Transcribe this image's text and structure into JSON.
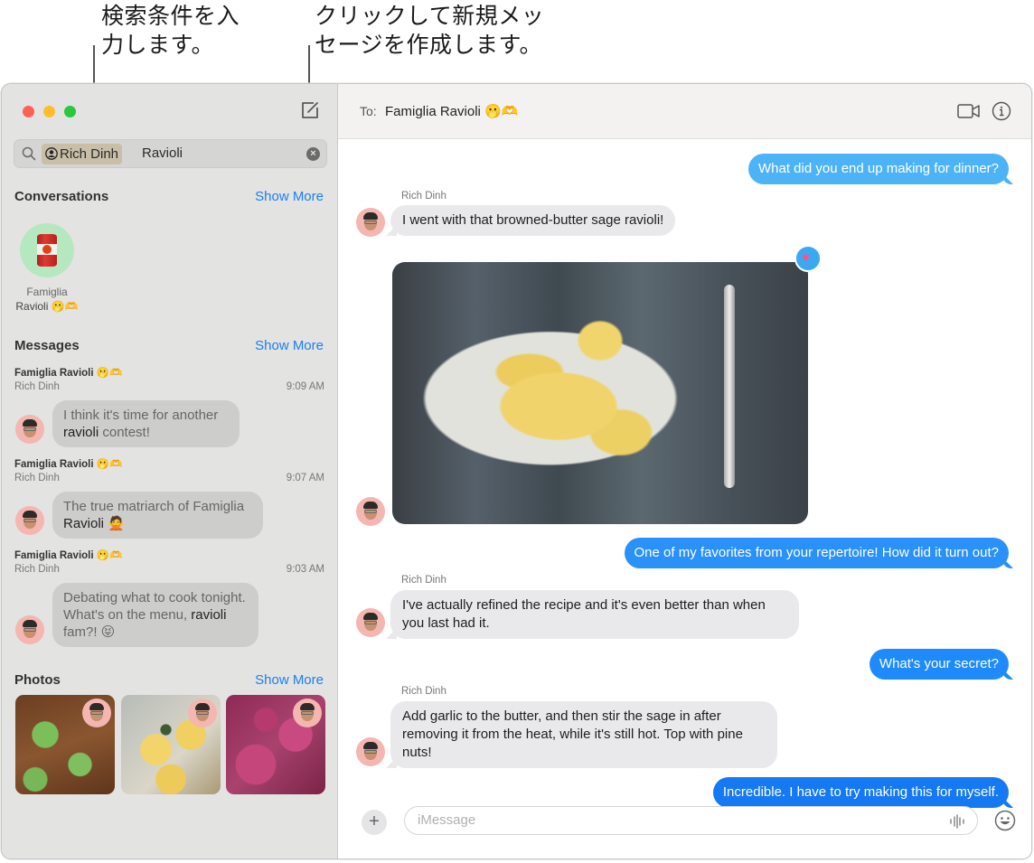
{
  "callouts": {
    "search": {
      "line1": "検索条件を入",
      "line2": "力します。"
    },
    "compose": {
      "line1": "クリックして新規メッ",
      "line2": "セージを作成します。"
    }
  },
  "sidebar": {
    "search": {
      "token": "Rich Dinh",
      "query": "Ravioli"
    },
    "conversations": {
      "title": "Conversations",
      "show_more": "Show More",
      "items": [
        {
          "name_line1": "Famiglia",
          "name_line2": "Ravioli 🫢🫶"
        }
      ]
    },
    "messages": {
      "title": "Messages",
      "show_more": "Show More",
      "items": [
        {
          "group": "Famiglia Ravioli 🫢🫶",
          "sender": "Rich Dinh",
          "time": "9:09 AM",
          "pre": "I think it's time for another ",
          "match": "ravioli",
          "post": " contest!"
        },
        {
          "group": "Famiglia Ravioli 🫢🫶",
          "sender": "Rich Dinh",
          "time": "9:07 AM",
          "pre": "The true matriarch of Famiglia ",
          "match": "Ravioli",
          "post": " 🙅"
        },
        {
          "group": "Famiglia Ravioli 🫢🫶",
          "sender": "Rich Dinh",
          "time": "9:03 AM",
          "pre": "Debating what to cook tonight. What's on the menu, ",
          "match": "ravioli",
          "post": " fam?! 😝"
        }
      ]
    },
    "photos": {
      "title": "Photos",
      "show_more": "Show More",
      "items": [
        "green spinach ravioli",
        "ravioli with sage",
        "beet ravioli"
      ]
    }
  },
  "main": {
    "header": {
      "to_label": "To:",
      "recipient": "Famiglia Ravioli 🫢🫶"
    },
    "messages": [
      {
        "direction": "out",
        "text": "What did you end up making for dinner?"
      },
      {
        "direction": "in",
        "sender": "Rich Dinh",
        "text": "I went with that browned-butter sage ravioli!"
      },
      {
        "direction": "in",
        "type": "photo",
        "description": "browned-butter sage ravioli on a plate",
        "tapback": "heart"
      },
      {
        "direction": "out",
        "text": "One of my favorites from your repertoire! How did it turn out?"
      },
      {
        "direction": "in",
        "sender": "Rich Dinh",
        "text": "I've actually refined the recipe and it's even better than when you last had it."
      },
      {
        "direction": "out",
        "text": "What's your secret?"
      },
      {
        "direction": "in",
        "sender": "Rich Dinh",
        "text": "Add garlic to the butter, and then stir the sage in after removing it from the heat, while it's still hot. Top with pine nuts!"
      },
      {
        "direction": "out",
        "text": "Incredible. I have to try making this for myself."
      }
    ],
    "composer": {
      "placeholder": "iMessage",
      "value": ""
    }
  },
  "colors": {
    "accent": "#1c7ff0",
    "outgoing_bubble": "#1f8bfa",
    "incoming_bubble": "#e9e9eb",
    "sidebar_bg": "#e3e3e2",
    "search_token": "#c9bfa9"
  }
}
